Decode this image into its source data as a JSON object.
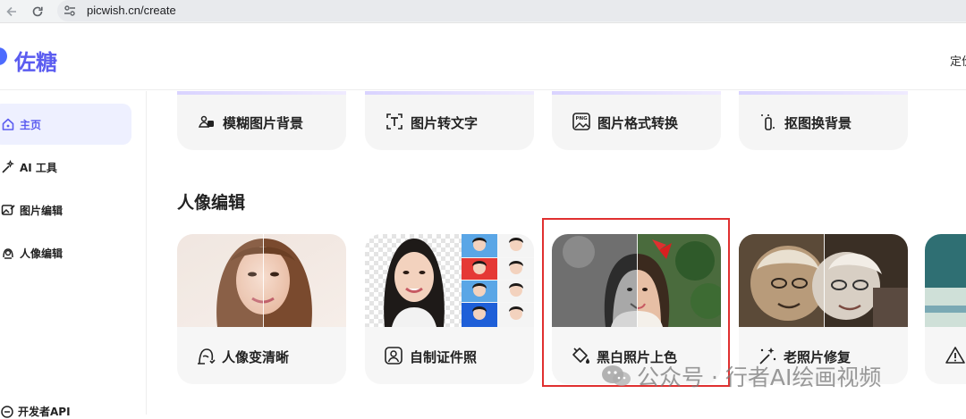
{
  "browser": {
    "url": "picwish.cn/create"
  },
  "header": {
    "logo": "佐糖",
    "right_text": "定价"
  },
  "sidebar": {
    "items": [
      {
        "label": "主页",
        "icon": "home-icon",
        "active": true
      },
      {
        "label": "AI 工具",
        "icon": "magic-wand-icon",
        "active": false
      },
      {
        "label": "图片编辑",
        "icon": "image-edit-icon",
        "active": false
      },
      {
        "label": "人像编辑",
        "icon": "portrait-icon",
        "active": false
      }
    ],
    "bottom_item": {
      "label": "开发者API",
      "icon": "api-icon"
    }
  },
  "top_tools": [
    {
      "label": "模糊图片背景",
      "icon": "blur-background-icon"
    },
    {
      "label": "图片转文字",
      "icon": "text-scan-icon"
    },
    {
      "label": "图片格式转换",
      "icon": "png-format-icon"
    },
    {
      "label": "抠图换背景",
      "icon": "cutout-icon"
    }
  ],
  "portrait_section": {
    "title": "人像编辑",
    "cards": [
      {
        "label": "人像变清晰",
        "icon": "face-enhance-icon"
      },
      {
        "label": "自制证件照",
        "icon": "id-photo-icon"
      },
      {
        "label": "黑白照片上色",
        "icon": "paint-bucket-icon"
      },
      {
        "label": "老照片修复",
        "icon": "sparkle-wand-icon"
      },
      {
        "label": "",
        "icon": "warning-icon"
      }
    ]
  },
  "watermark": {
    "text": "公众号 · 行者AI绘画视频"
  },
  "colors": {
    "accent": "#5b5cf0",
    "highlight": "#e03030",
    "card_bg": "#f6f6f6"
  }
}
